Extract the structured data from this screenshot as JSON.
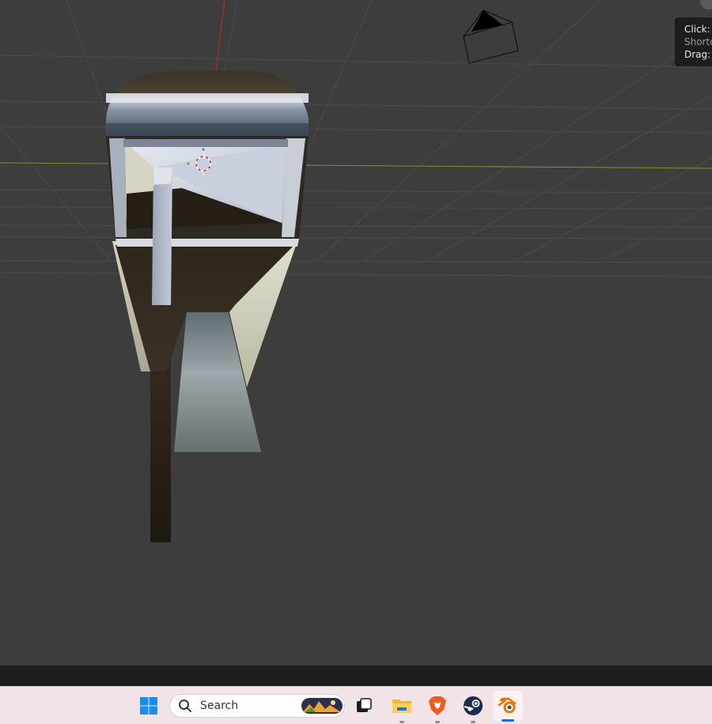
{
  "viewport": {
    "tooltip": {
      "line1": "Click: U",
      "line2": "Shortc",
      "line3": "Drag: F"
    }
  },
  "taskbar": {
    "search_label": "Search",
    "icons": [
      "windows-start-icon",
      "search-icon",
      "task-view-icon",
      "file-explorer-icon",
      "brave-browser-icon",
      "steam-icon",
      "blender-icon"
    ],
    "colors": {
      "windows_blue": "#1a8ef0",
      "brave_orange": "#f25a24",
      "steam_navy": "#1b2c4f",
      "blender_orange": "#ea7600",
      "blender_blue": "#265787"
    }
  },
  "scene": {
    "background": "#3d3d3d",
    "x_axis_color": "#6e9a2e",
    "z_axis_color": "#c02a2a"
  }
}
